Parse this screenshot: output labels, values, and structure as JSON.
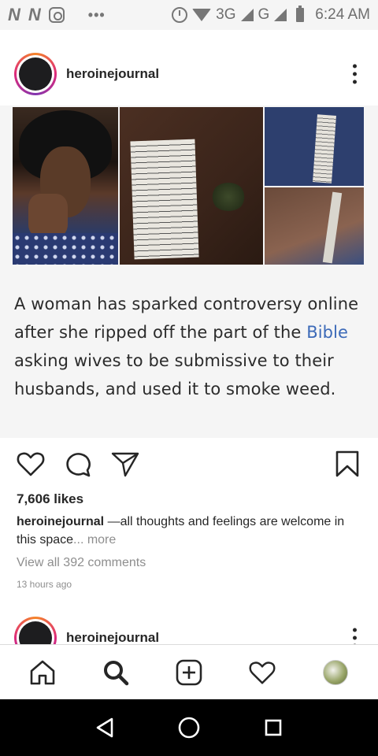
{
  "status_bar": {
    "left_icons": [
      "n-notification-icon",
      "n-notification-icon",
      "instagram-notification-icon",
      "more-notifications-icon"
    ],
    "network_label_1": "3G",
    "network_label_2": "G",
    "time": "6:24 AM"
  },
  "post": {
    "username": "heroinejournal",
    "image_caption": {
      "before": "A woman has sparked controversy online after she ripped off the part of the ",
      "highlight": "Bible",
      "after": " asking wives to be submissive to their husbands, and used it to smoke weed."
    },
    "likes": "7,606 likes",
    "caption_user": "heroinejournal",
    "caption_text": " —all thoughts and feelings are welcome in this space",
    "caption_more": "... more",
    "view_comments": "View all 392 comments",
    "timestamp": "13 hours ago"
  },
  "next_post": {
    "username": "heroinejournal"
  },
  "icons": {
    "like": "heart-outline-icon",
    "comment": "comment-bubble-icon",
    "share": "paper-plane-icon",
    "save": "bookmark-icon",
    "home": "home-icon",
    "search": "search-icon",
    "new_post": "plus-square-icon",
    "activity": "heart-icon",
    "profile": "profile-avatar-icon"
  },
  "colors": {
    "story_ring_start": "#f58529",
    "story_ring_mid": "#dd2a7b",
    "highlight_text": "#3c6ab8",
    "muted_text": "#8e8e8e"
  }
}
